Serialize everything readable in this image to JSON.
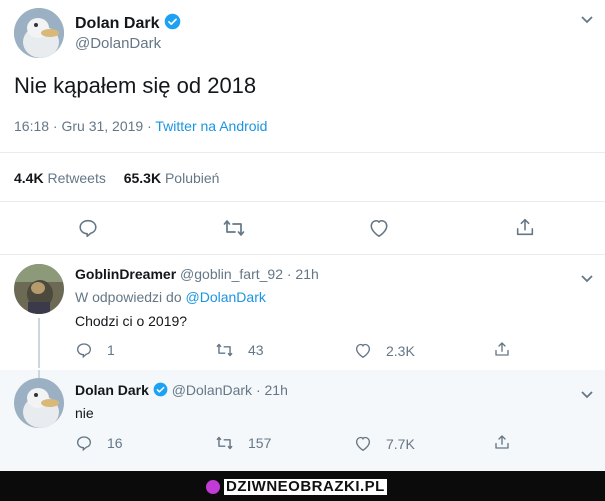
{
  "main_tweet": {
    "author_name": "Dolan Dark",
    "handle": "@DolanDark",
    "text": "Nie kąpałem się od 2018",
    "time": "16:18 · Gru 31, 2019 · ",
    "source": "Twitter na Android",
    "retweets_count": "4.4K",
    "retweets_label": "Retweets",
    "likes_count": "65.3K",
    "likes_label": "Polubień"
  },
  "replies": [
    {
      "author_name": "GoblinDreamer",
      "handle": "@goblin_fart_92",
      "age": "· 21h",
      "reply_prefix": "W odpowiedzi do ",
      "reply_to": "@DolanDark",
      "text": "Chodzi ci o 2019?",
      "reply_count": "1",
      "retweet_count": "43",
      "like_count": "2.3K"
    },
    {
      "author_name": "Dolan Dark",
      "handle": "@DolanDark",
      "age": "· 21h",
      "text": "nie",
      "reply_count": "16",
      "retweet_count": "157",
      "like_count": "7.7K"
    }
  ],
  "watermark": "DZIWNEOBRAZKI.PL",
  "colors": {
    "accent": "#1b95e0",
    "muted": "#657786",
    "verified": "#1da1f2",
    "highlight_bg": "#f5f8fa",
    "watermark_dot": "#c33bd6"
  }
}
